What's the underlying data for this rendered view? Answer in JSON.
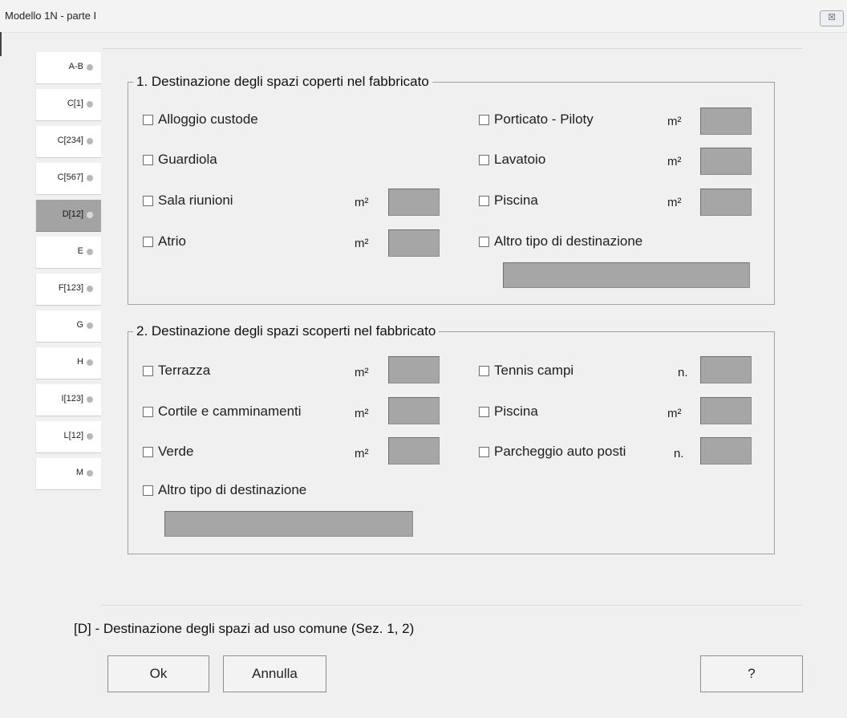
{
  "window": {
    "title": "Modello 1N  -   parte I",
    "close_glyph": "☒"
  },
  "tabs": [
    {
      "label": "A-B",
      "active": false
    },
    {
      "label": "C[1]",
      "active": false
    },
    {
      "label": "C[234]",
      "active": false
    },
    {
      "label": "C[567]",
      "active": false
    },
    {
      "label": "D[12]",
      "active": true
    },
    {
      "label": "E",
      "active": false
    },
    {
      "label": "F[123]",
      "active": false
    },
    {
      "label": "G",
      "active": false
    },
    {
      "label": "H",
      "active": false
    },
    {
      "label": "I[123]",
      "active": false
    },
    {
      "label": "L[12]",
      "active": false
    },
    {
      "label": "M",
      "active": false
    }
  ],
  "section1": {
    "title": "1. Destinazione degli spazi coperti nel fabbricato",
    "items": {
      "alloggio": "Alloggio custode",
      "guardiola": "Guardiola",
      "sala": "Sala riunioni",
      "atrio": "Atrio",
      "porticato": "Porticato - Piloty",
      "lavatoio": "Lavatoio",
      "piscina": "Piscina",
      "altro": "Altro tipo di destinazione"
    }
  },
  "section2": {
    "title": "2.  Destinazione degli spazi scoperti nel fabbricato",
    "items": {
      "terrazza": "Terrazza",
      "cortile": "Cortile e camminamenti",
      "verde": "Verde",
      "altro": "Altro tipo di destinazione",
      "tennis": "Tennis campi",
      "piscina": "Piscina",
      "parcheggio": "Parcheggio auto posti"
    }
  },
  "units": {
    "m2": "m²",
    "n": "n."
  },
  "footer": {
    "text": "[D] - Destinazione degli spazi ad uso comune (Sez. 1, 2)"
  },
  "buttons": {
    "ok": "Ok",
    "cancel": "Annulla",
    "help": "?"
  }
}
